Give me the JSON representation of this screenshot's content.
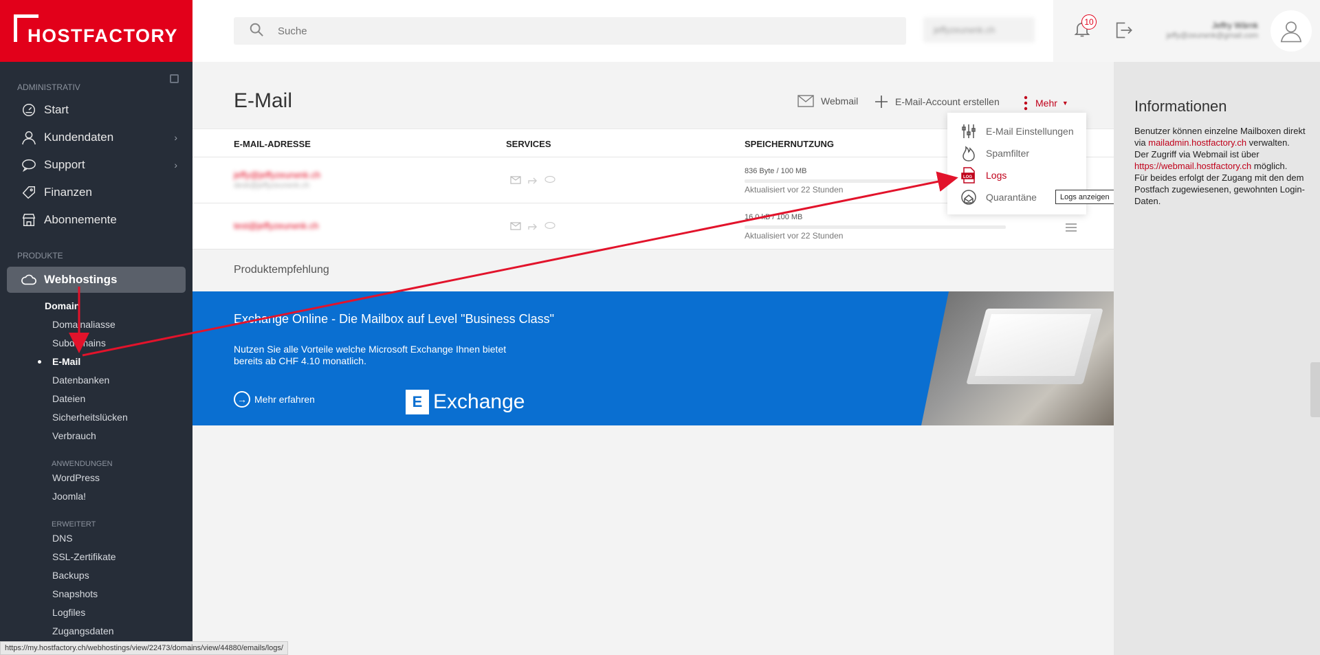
{
  "brand": {
    "name": "HOSTFACTORY",
    "accent": "#e2001a",
    "sidebar_bg": "#262d38"
  },
  "sidebar": {
    "section_admin": "ADMINISTRATIV",
    "items": [
      {
        "label": "Start",
        "icon": "gauge-icon"
      },
      {
        "label": "Kundendaten",
        "icon": "user-icon"
      },
      {
        "label": "Support",
        "icon": "chat-icon"
      },
      {
        "label": "Finanzen",
        "icon": "tag-icon"
      },
      {
        "label": "Abonnemente",
        "icon": "store-icon"
      }
    ],
    "section_products": "PRODUKTE",
    "active_product": "Webhostings",
    "sub_head": "Domain",
    "sub_items": [
      "Domainaliasse",
      "Subdomains",
      "E-Mail",
      "Datenbanken",
      "Dateien",
      "Sicherheitslücken",
      "Verbrauch"
    ],
    "label_apps": "ANWENDUNGEN",
    "apps": [
      "WordPress",
      "Joomla!"
    ],
    "label_advanced": "ERWEITERT",
    "advanced": [
      "DNS",
      "SSL-Zertifikate",
      "Backups",
      "Snapshots",
      "Logfiles",
      "Zugangsdaten"
    ]
  },
  "topbar": {
    "search_placeholder": "Suche",
    "account_value": "jeffyzeurwnk.ch",
    "notifications_count": "10",
    "user_name": "Jeffry Wärnk",
    "user_email": "jeffy@zeurwnk@gmail.com"
  },
  "main": {
    "title": "E-Mail",
    "actions": {
      "webmail": "Webmail",
      "create": "E-Mail-Account erstellen",
      "more": "Mehr"
    },
    "table": {
      "headers": [
        "E-MAIL-ADRESSE",
        "SERVICES",
        "SPEICHERNUTZUNG"
      ],
      "rows": [
        {
          "email": "jeffy@jeffyzeurwnk.ch",
          "alias": "desk@jeffyzeurwnk.ch",
          "usage": "836 Byte / 100 MB",
          "updated": "Aktualisiert vor 22 Stunden"
        },
        {
          "email": "test@jeffyzeurwnk.ch",
          "alias": "",
          "usage": "16.0 kB / 100 MB",
          "updated": "Aktualisiert vor 22 Stunden"
        }
      ]
    },
    "product_recommendation": "Produktempfehlung",
    "banner": {
      "title": "Exchange Online - Die Mailbox auf Level \"Business Class\"",
      "text": "Nutzen Sie alle Vorteile welche Microsoft Exchange Ihnen bietet bereits ab CHF 4.10 monatlich.",
      "cta": "Mehr erfahren",
      "logo_text": "Exchange",
      "color": "#0a6fd1"
    }
  },
  "dropdown": {
    "items": [
      {
        "label": "E-Mail Einstellungen",
        "icon": "sliders-icon"
      },
      {
        "label": "Spamfilter",
        "icon": "flame-icon"
      },
      {
        "label": "Logs",
        "icon": "log-file-icon"
      },
      {
        "label": "Quarantäne",
        "icon": "quarantine-icon"
      }
    ],
    "tooltip": "Logs anzeigen"
  },
  "info": {
    "title": "Informationen",
    "p1_before": "Benutzer können einzelne Mailboxen direkt via ",
    "link1": "mailadmin.hostfactory.ch",
    "p1_after": " verwalten. Der Zugriff via Webmail ist über ",
    "link2": "https://webmail.hostfactory.ch",
    "p1_end": " möglich.",
    "p2": "Für beides erfolgt der Zugang mit den dem Postfach zugewiesenen, gewohnten Login-Daten."
  },
  "status_url": "https://my.hostfactory.ch/webhostings/view/22473/domains/view/44880/emails/logs/"
}
